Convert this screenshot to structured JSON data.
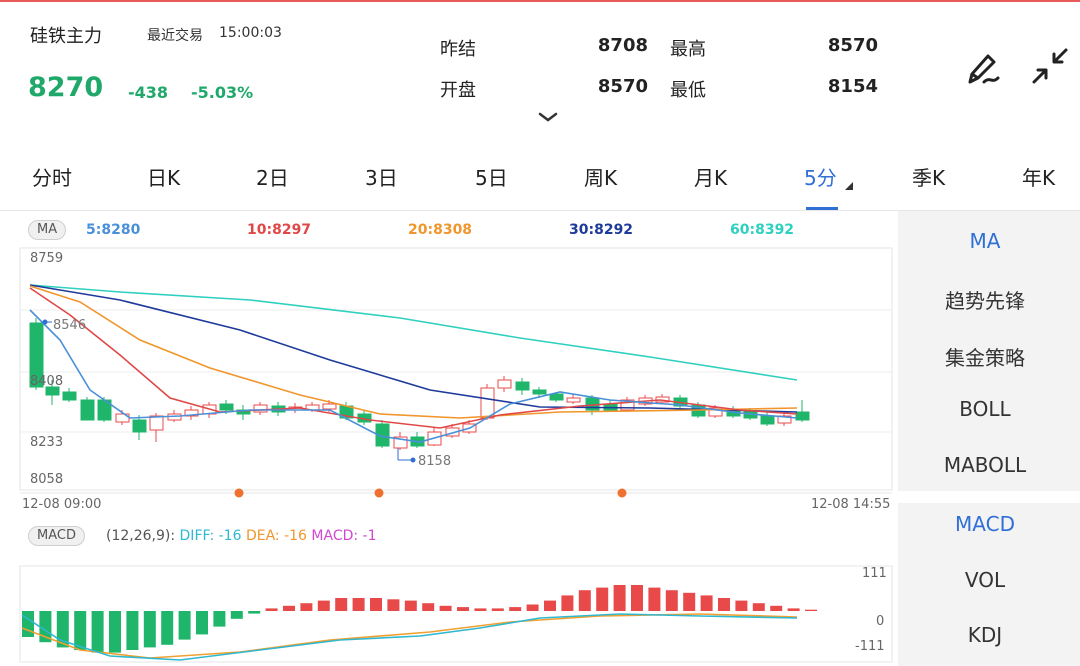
{
  "header": {
    "name": "硅铁主力",
    "recent_label": "最近交易",
    "time": "15:00:03",
    "price": "8270",
    "change": "-438",
    "change_pct": "-5.03%",
    "quotes": [
      {
        "label": "昨结",
        "value": "8708"
      },
      {
        "label": "最高",
        "value": "8570"
      },
      {
        "label": "开盘",
        "value": "8570"
      },
      {
        "label": "最低",
        "value": "8154"
      }
    ]
  },
  "tabs": [
    "分时",
    "日K",
    "2日",
    "3日",
    "5日",
    "周K",
    "月K",
    "5分",
    "季K",
    "年K"
  ],
  "active_tab": "5分",
  "ma": {
    "badge": "MA",
    "values": [
      {
        "text": "5:8280",
        "color": "#4a90d9"
      },
      {
        "text": "10:8297",
        "color": "#e04848"
      },
      {
        "text": "20:8308",
        "color": "#f0962c"
      },
      {
        "text": "30:8292",
        "color": "#1e3a9a"
      },
      {
        "text": "60:8392",
        "color": "#2fd0c0"
      }
    ]
  },
  "price_axis": [
    "8759",
    "8408",
    "8233",
    "8058"
  ],
  "annotations": {
    "high": "8546",
    "low": "8158"
  },
  "time_axis": {
    "start": "12-08 09:00",
    "end": "12-08 14:55"
  },
  "macd": {
    "badge": "MACD",
    "params": "(12,26,9):",
    "diff": "DIFF: -16",
    "dea": "DEA: -16",
    "macd": "MACD: -1",
    "axis": [
      "111",
      "0",
      "-111"
    ]
  },
  "right_panel": {
    "main": [
      "MA",
      "趋势先锋",
      "集金策略",
      "BOLL",
      "MABOLL"
    ],
    "sub": [
      "MACD",
      "VOL",
      "KDJ"
    ]
  },
  "colors": {
    "up": "#e84a4a",
    "down": "#1fb56a",
    "accent": "#2f6fd6"
  }
}
